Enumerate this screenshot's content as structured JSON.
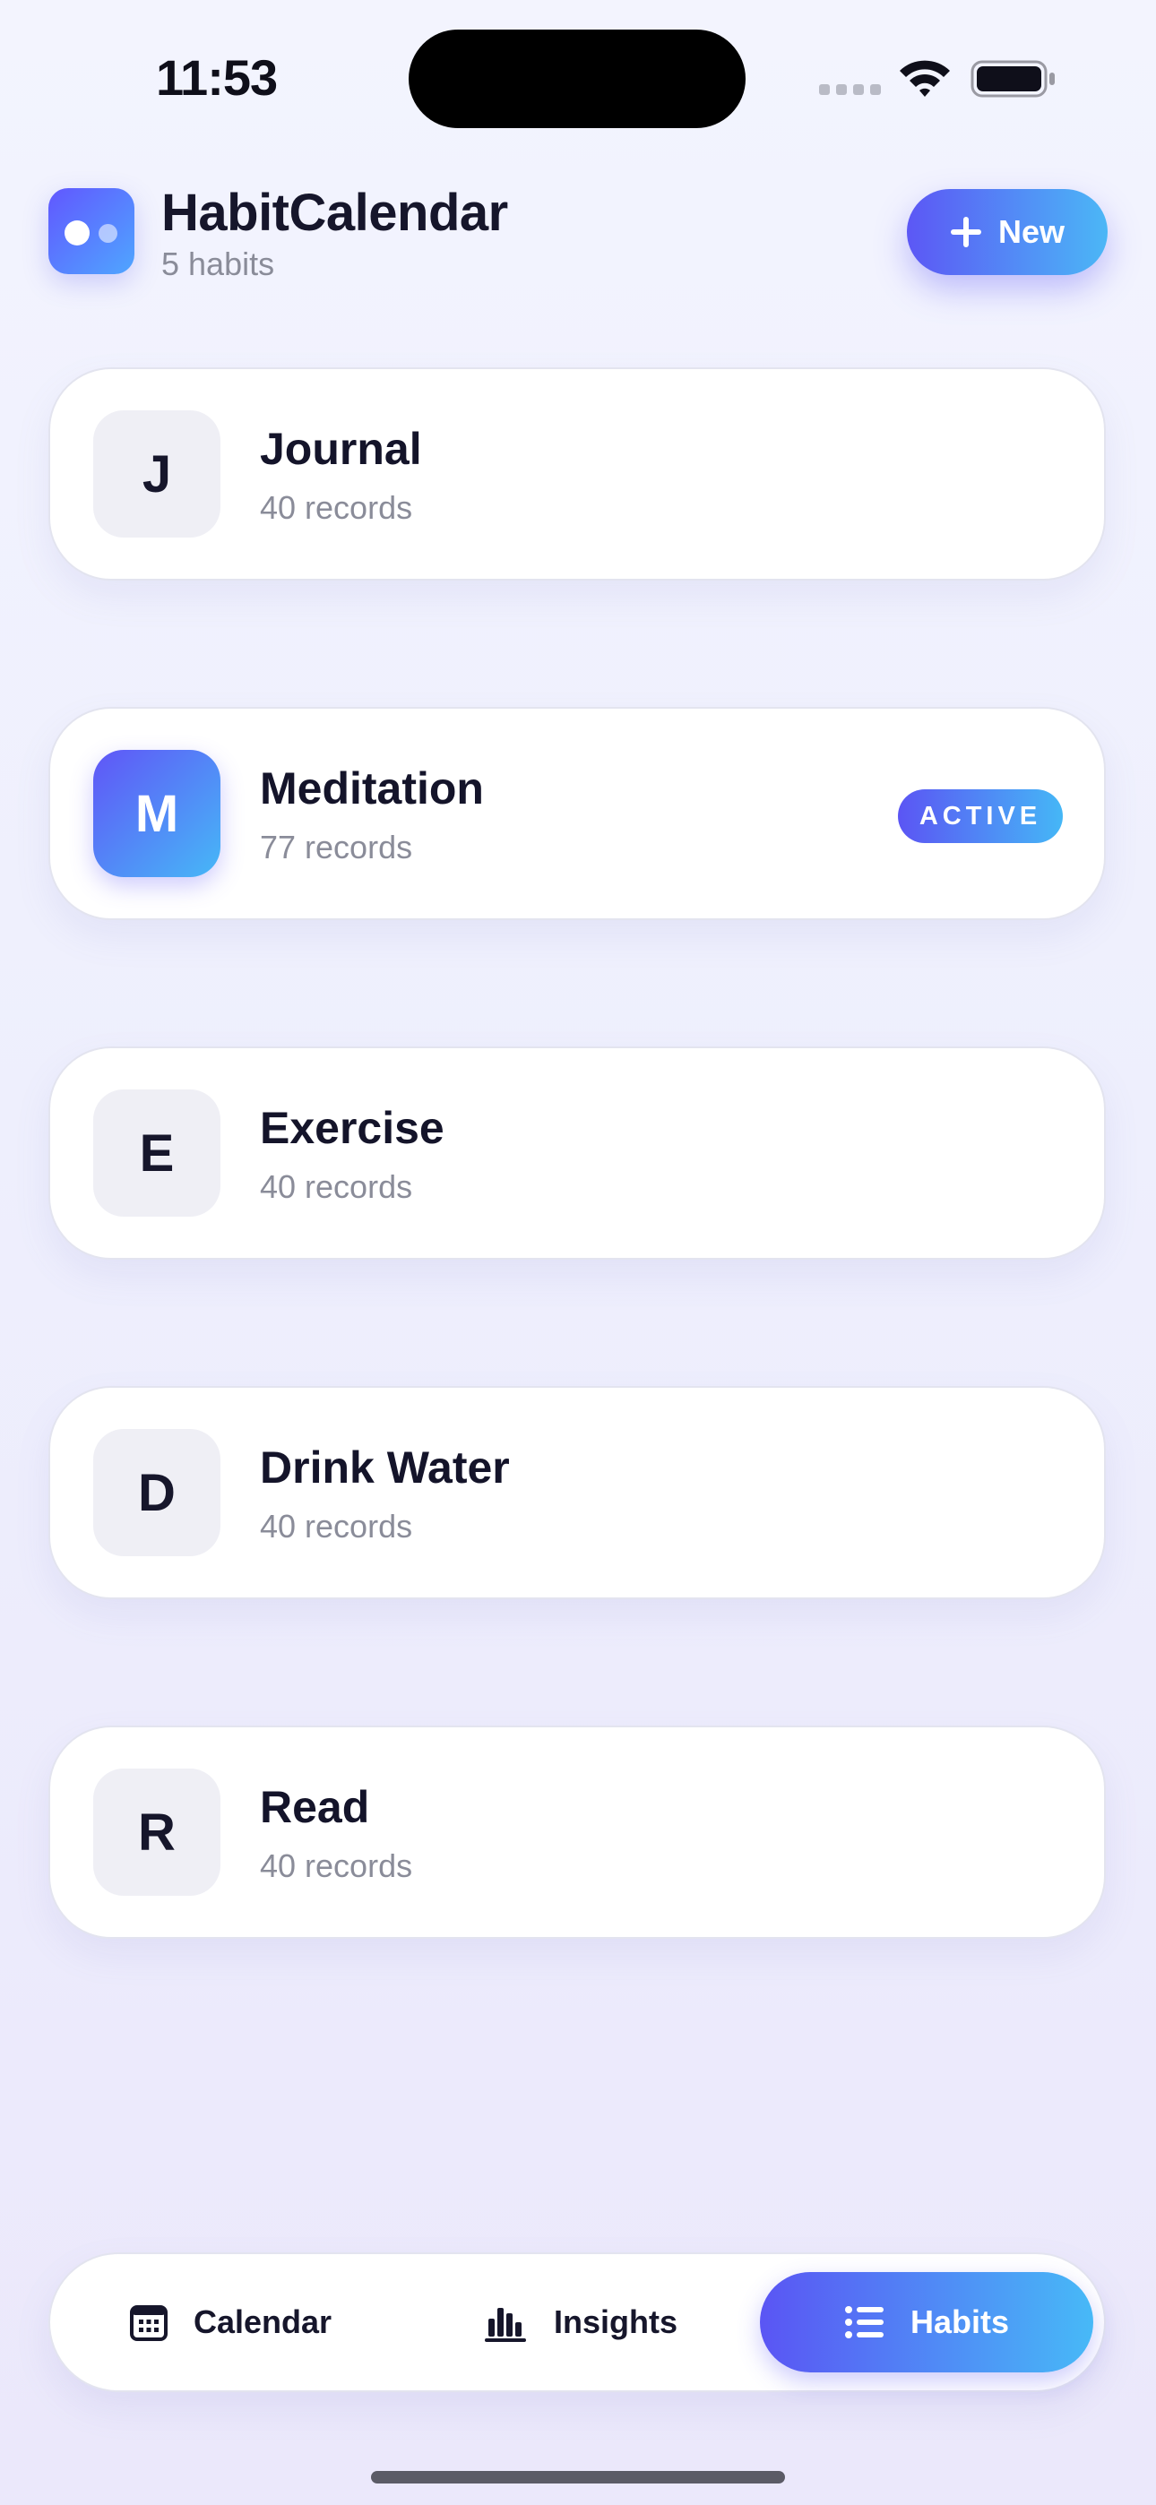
{
  "status_bar": {
    "time": "11:53"
  },
  "header": {
    "title": "HabitCalendar",
    "subtitle": "5 habits",
    "new_button_label": "New"
  },
  "habits": [
    {
      "initial": "J",
      "name": "Journal",
      "records": "40 records",
      "active": false
    },
    {
      "initial": "M",
      "name": "Meditation",
      "records": "77 records",
      "active": true,
      "badge": "ACTIVE"
    },
    {
      "initial": "E",
      "name": "Exercise",
      "records": "40 records",
      "active": false
    },
    {
      "initial": "D",
      "name": "Drink Water",
      "records": "40 records",
      "active": false
    },
    {
      "initial": "R",
      "name": "Read",
      "records": "40 records",
      "active": false
    }
  ],
  "tab_bar": {
    "tabs": [
      {
        "label": "Calendar",
        "icon": "calendar-icon",
        "selected": false
      },
      {
        "label": "Insights",
        "icon": "bar-chart-icon",
        "selected": false
      },
      {
        "label": "Habits",
        "icon": "list-icon",
        "selected": true
      }
    ]
  },
  "colors": {
    "accent_start": "#5c57f5",
    "accent_end": "#4bb7f6",
    "text_primary": "#16162b",
    "text_secondary": "#8a8c99"
  }
}
